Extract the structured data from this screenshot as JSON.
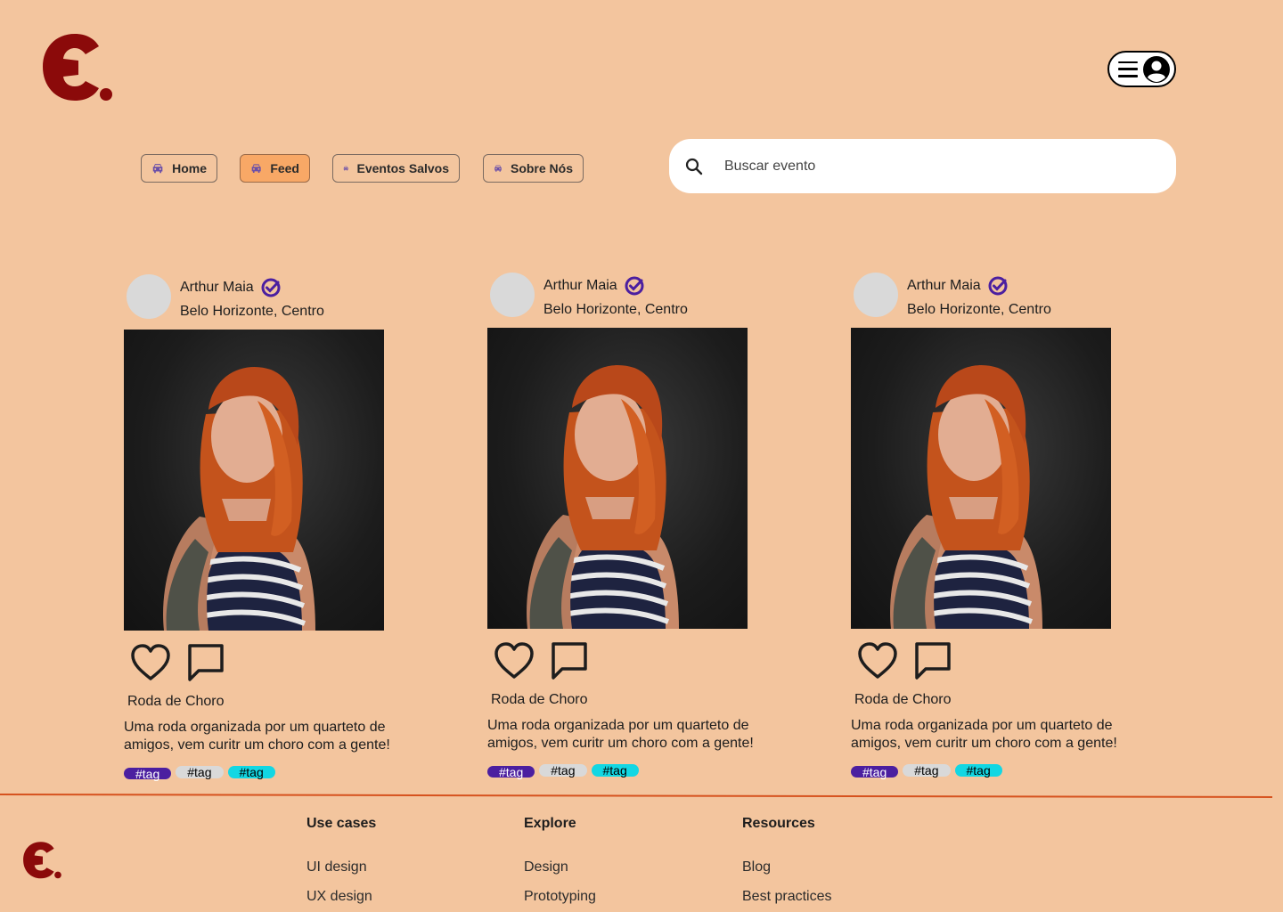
{
  "header": {
    "logo_icon": "event-logo-e",
    "menu_icon": "hamburger-icon",
    "profile_icon": "user-profile-icon"
  },
  "nav": {
    "items": [
      {
        "label": "Home",
        "icon": "car-icon",
        "active": false
      },
      {
        "label": "Feed",
        "icon": "car-icon",
        "active": true
      },
      {
        "label": "Eventos Salvos",
        "icon": "car-icon",
        "active": false
      },
      {
        "label": "Sobre Nós",
        "icon": "car-icon",
        "active": false
      }
    ]
  },
  "search": {
    "placeholder": "Buscar evento",
    "icon": "search-icon"
  },
  "posts": [
    {
      "author": "Arthur Maia",
      "verified_icon": "verified-badge-icon",
      "location": "Belo Horizonte, Centro",
      "title": "Roda de Choro",
      "description": "Uma roda organizada por um quarteto de amigos, vem curitr um choro com a gente!",
      "tags": [
        "#tag",
        "#tag",
        "#tag"
      ]
    },
    {
      "author": "Arthur Maia",
      "verified_icon": "verified-badge-icon",
      "location": "Belo Horizonte, Centro",
      "title": "Roda de Choro",
      "description": "Uma roda organizada por um quarteto de amigos, vem curitr um choro com a gente!",
      "tags": [
        "#tag",
        "#tag",
        "#tag"
      ]
    },
    {
      "author": "Arthur Maia",
      "verified_icon": "verified-badge-icon",
      "location": "Belo Horizonte, Centro",
      "title": "Roda de Choro",
      "description": "Uma roda organizada por um quarteto de amigos, vem curitr um choro com a gente!",
      "tags": [
        "#tag",
        "#tag",
        "#tag"
      ]
    }
  ],
  "footer": {
    "columns": [
      {
        "heading": "Use cases",
        "links": [
          "UI design",
          "UX design"
        ]
      },
      {
        "heading": "Explore",
        "links": [
          "Design",
          "Prototyping"
        ]
      },
      {
        "heading": "Resources",
        "links": [
          "Blog",
          "Best practices"
        ]
      }
    ]
  },
  "colors": {
    "background": "#F3C59E",
    "brand": "#8B0A0A",
    "active_nav": "#F8A866",
    "verified": "#4b1fa0",
    "tag_purple": "#4b1fa0",
    "tag_gray": "#d9d9d9",
    "tag_cyan": "#12d7e3",
    "divider": "#d6521e"
  }
}
